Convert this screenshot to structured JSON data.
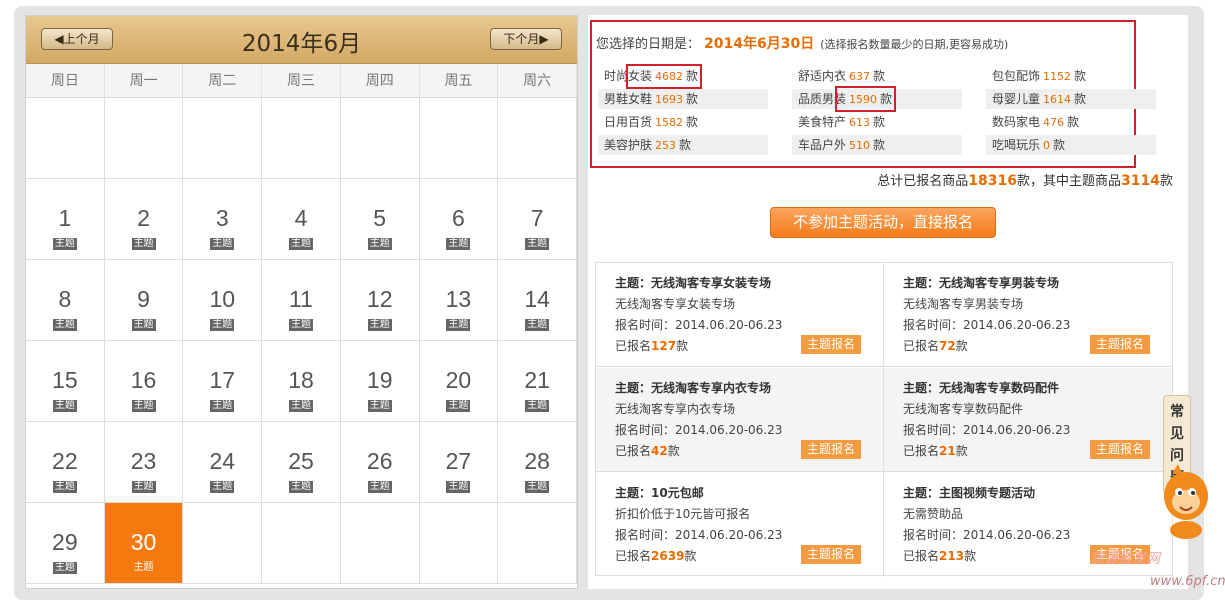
{
  "calendar": {
    "prev": "◀上个月",
    "next": "下个月▶",
    "title": "2014年6月",
    "weekdays": [
      "周日",
      "周一",
      "周二",
      "周三",
      "周四",
      "周五",
      "周六"
    ],
    "tag": "主题",
    "days": [
      [
        "",
        "",
        "",
        "",
        "",
        "",
        ""
      ],
      [
        "1",
        "2",
        "3",
        "4",
        "5",
        "6",
        "7"
      ],
      [
        "8",
        "9",
        "10",
        "11",
        "12",
        "13",
        "14"
      ],
      [
        "15",
        "16",
        "17",
        "18",
        "19",
        "20",
        "21"
      ],
      [
        "22",
        "23",
        "24",
        "25",
        "26",
        "27",
        "28"
      ],
      [
        "29",
        "30",
        "",
        "",
        "",
        "",
        ""
      ]
    ],
    "selected": "30"
  },
  "selection": {
    "label": "您选择的日期是：",
    "date": "2014年6月30日",
    "hint": "(选择报名数量最少的日期,更容易成功)"
  },
  "categories": [
    {
      "name": "时尚女装",
      "count": "4682",
      "unit": "款"
    },
    {
      "name": "舒适内衣",
      "count": "637",
      "unit": "款"
    },
    {
      "name": "包包配饰",
      "count": "1152",
      "unit": "款"
    },
    {
      "name": "男鞋女鞋",
      "count": "1693",
      "unit": "款"
    },
    {
      "name": "品质男装",
      "count": "1590",
      "unit": "款"
    },
    {
      "name": "母婴儿童",
      "count": "1614",
      "unit": "款"
    },
    {
      "name": "日用百货",
      "count": "1582",
      "unit": "款"
    },
    {
      "name": "美食特产",
      "count": "613",
      "unit": "款"
    },
    {
      "name": "数码家电",
      "count": "476",
      "unit": "款"
    },
    {
      "name": "美容护肤",
      "count": "253",
      "unit": "款"
    },
    {
      "name": "车品户外",
      "count": "510",
      "unit": "款"
    },
    {
      "name": "吃喝玩乐",
      "count": "0",
      "unit": "款"
    }
  ],
  "total": {
    "p1": "总计已报名商品",
    "all": "18316",
    "p2": "款，其中主题商品",
    "theme": "3114",
    "p3": "款"
  },
  "direct_button": "不参加主题活动，直接报名",
  "themes": [
    {
      "title": "主题：无线淘客专享女装专场",
      "desc": "无线淘客专享女装专场",
      "time": "报名时间：2014.06.20-06.23",
      "pre": "已报名",
      "count": "127",
      "unit": "款",
      "btn": "主题报名"
    },
    {
      "title": "主题：无线淘客专享男装专场",
      "desc": "无线淘客专享男装专场",
      "time": "报名时间：2014.06.20-06.23",
      "pre": "已报名",
      "count": "72",
      "unit": "款",
      "btn": "主题报名"
    },
    {
      "title": "主题：无线淘客专享内衣专场",
      "desc": "无线淘客专享内衣专场",
      "time": "报名时间：2014.06.20-06.23",
      "pre": "已报名",
      "count": "42",
      "unit": "款",
      "btn": "主题报名"
    },
    {
      "title": "主题：无线淘客专享数码配件",
      "desc": "无线淘客专享数码配件",
      "time": "报名时间：2014.06.20-06.23",
      "pre": "已报名",
      "count": "21",
      "unit": "款",
      "btn": "主题报名"
    },
    {
      "title": "主题：10元包邮",
      "desc": "折扣价低于10元皆可报名",
      "time": "报名时间：2014.06.20-06.23",
      "pre": "已报名",
      "count": "2639",
      "unit": "款",
      "btn": "主题报名"
    },
    {
      "title": "主题：主图视频专题活动",
      "desc": "无需赞助品",
      "time": "报名时间：2014.06.20-06.23",
      "pre": "已报名",
      "count": "213",
      "unit": "款",
      "btn": "主题报名"
    }
  ],
  "faq": [
    "常",
    "见",
    "问",
    "题"
  ],
  "watermark": "货源批发网",
  "watermark2": "www.6pf.cn",
  "colors": {
    "accent": "#e96c00",
    "selected": "#f47a10",
    "highlight": "#d0202b"
  }
}
